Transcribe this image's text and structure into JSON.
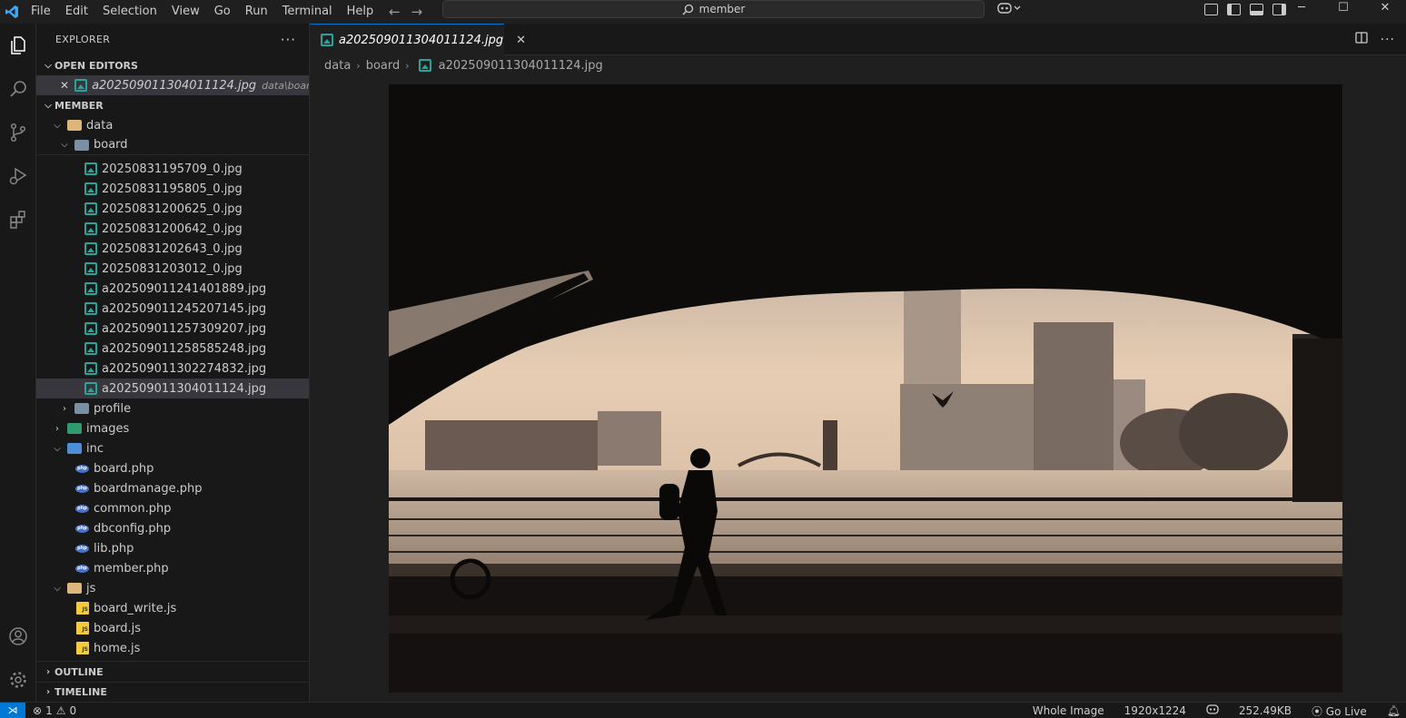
{
  "titlebar": {
    "menu": [
      "File",
      "Edit",
      "Selection",
      "View",
      "Go",
      "Run",
      "Terminal",
      "Help"
    ],
    "search_text": "member"
  },
  "sidebar": {
    "title": "EXPLORER",
    "open_editors_label": "OPEN EDITORS",
    "open_editor": {
      "name": "a202509011304011124.jpg",
      "path": "data\\board"
    },
    "workspace_label": "MEMBER",
    "data_folder": "data",
    "board_folder": "board",
    "board_files": [
      "20250831195709_0.jpg",
      "20250831195805_0.jpg",
      "20250831200625_0.jpg",
      "20250831200642_0.jpg",
      "20250831202643_0.jpg",
      "20250831203012_0.jpg",
      "a202509011241401889.jpg",
      "a202509011245207145.jpg",
      "a202509011257309207.jpg",
      "a202509011258585248.jpg",
      "a202509011302274832.jpg",
      "a202509011304011124.jpg"
    ],
    "profile_folder": "profile",
    "images_folder": "images",
    "inc_folder": "inc",
    "inc_files": [
      "board.php",
      "boardmanage.php",
      "common.php",
      "dbconfig.php",
      "lib.php",
      "member.php"
    ],
    "js_folder": "js",
    "js_files": [
      "board_write.js",
      "board.js",
      "home.js"
    ],
    "outline_label": "OUTLINE",
    "timeline_label": "TIMELINE"
  },
  "editor": {
    "tab_name": "a202509011304011124.jpg",
    "breadcrumb": [
      "data",
      "board",
      "a202509011304011124.jpg"
    ]
  },
  "statusbar": {
    "errors": "1",
    "warnings": "0",
    "zoom": "Whole Image",
    "dimensions": "1920x1224",
    "size": "252.49KB",
    "golive": "Go Live"
  },
  "colors": {
    "accent": "#0078d4",
    "image_icon": "#26a69a",
    "selection": "#37373d"
  }
}
